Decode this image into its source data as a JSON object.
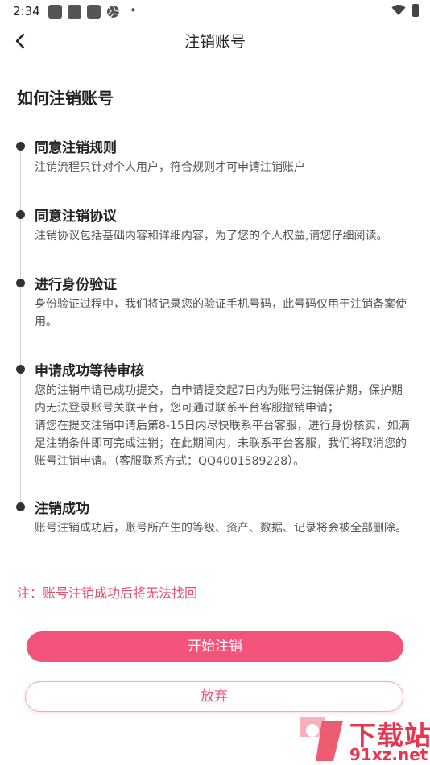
{
  "status_bar": {
    "time": "2:34",
    "dot": "•"
  },
  "nav": {
    "title": "注销账号",
    "back_icon": "chevron-left-icon"
  },
  "heading": "如何注销账号",
  "steps": [
    {
      "title": "同意注销规则",
      "desc": "注销流程只针对个人用户，符合规则才可申请注销账户"
    },
    {
      "title": "同意注销协议",
      "desc": "注销协议包括基础内容和详细内容，为了您的个人权益,请您仔细阅读。"
    },
    {
      "title": "进行身份验证",
      "desc": "身份验证过程中，我们将记录您的验证手机号码，此号码仅用于注销备案使用。"
    },
    {
      "title": "申请成功等待审核",
      "desc": "您的注销申请已成功提交，自申请提交起7日内为账号注销保护期，保护期内无法登录账号关联平台，您可通过联系平台客服撤销申请；\n 请您在提交注销申请后第8-15日内尽快联系平台客服，进行身份核实，如满足注销条件即可完成注销；在此期间内，未联系平台客服，我们将取消您的账号注销申请。（客服联系方式：QQ4001589228）。"
    },
    {
      "title": "注销成功",
      "desc": "账号注销成功后，账号所产生的等级、资产、数据、记录将会被全部删除。"
    }
  ],
  "note": "注：账号注销成功后将无法找回",
  "buttons": {
    "start": "开始注销",
    "quit": "放弃"
  },
  "watermark": {
    "text": "下载站",
    "url": "91xz.net"
  },
  "colors": {
    "accent": "#f2537a",
    "note": "#e8506a",
    "watermark": "#e8344e"
  }
}
